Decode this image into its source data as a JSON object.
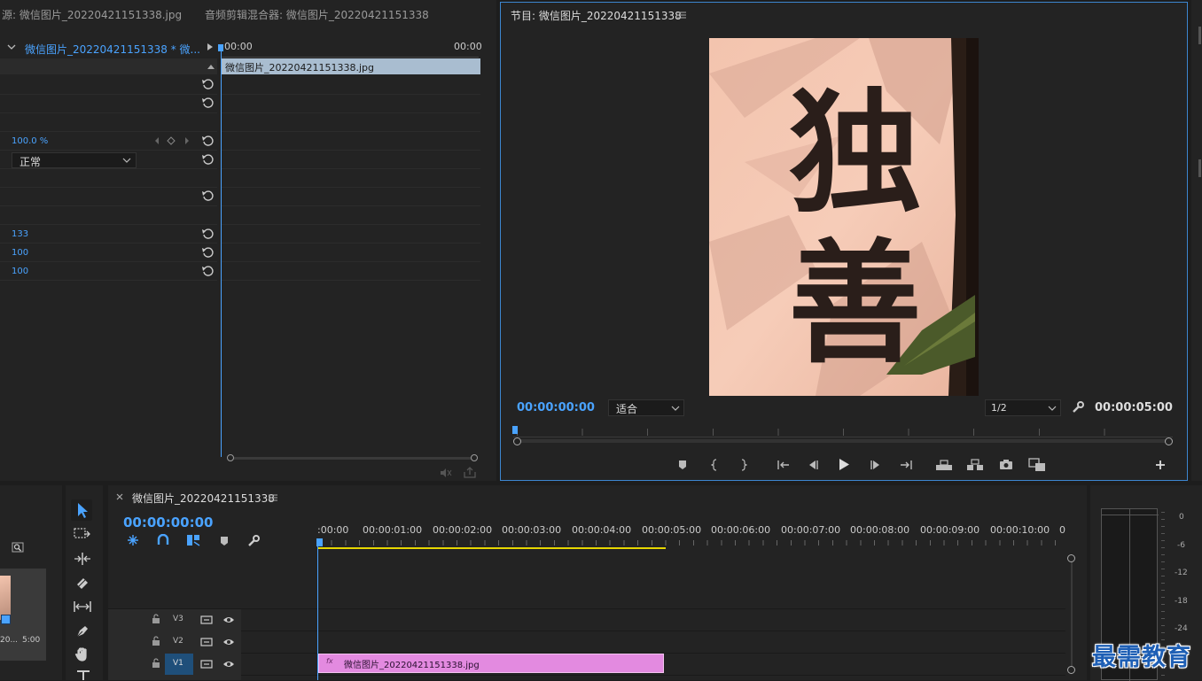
{
  "tabs": {
    "source": "源: 微信图片_20220421151338.jpg",
    "audio_mixer": "音频剪辑混合器: 微信图片_20220421151338",
    "program": "节目: 微信图片_20220421151338"
  },
  "effect_controls": {
    "clip_name": "微信图片_20220421151338 * 微...",
    "timeline_start": "00:00",
    "timeline_end": "00:00",
    "clip_bar_label": "微信图片_20220421151338.jpg",
    "opacity_value": "100.0 %",
    "blend_mode": "正常",
    "value_a": "133",
    "value_b": "100",
    "value_c": "100"
  },
  "program_monitor": {
    "timecode": "00:00:00:00",
    "fit": "适合",
    "resolution": "1/2",
    "duration": "00:00:05:00",
    "image_text": "独善"
  },
  "project": {
    "thumb_label": "20...",
    "thumb_duration": "5:00"
  },
  "timeline": {
    "title": "微信图片_20220421151338",
    "timecode": "00:00:00:00",
    "ruler": [
      ":00:00",
      "00:00:01:00",
      "00:00:02:00",
      "00:00:03:00",
      "00:00:04:00",
      "00:00:05:00",
      "00:00:06:00",
      "00:00:07:00",
      "00:00:08:00",
      "00:00:09:00",
      "00:00:10:00",
      "0"
    ],
    "tracks": [
      "V3",
      "V2",
      "V1"
    ],
    "clip_label": "微信图片_20220421151338.jpg",
    "fx_badge": "fx"
  },
  "audio_meter": {
    "scale": [
      "0",
      "-6",
      "-12",
      "-18",
      "-24"
    ]
  },
  "watermark": "最需教育",
  "colors": {
    "accent": "#4aa3ff",
    "clip": "#e38ae0",
    "work_area": "#e6d600",
    "clip_bar": "#a9bdd0"
  }
}
